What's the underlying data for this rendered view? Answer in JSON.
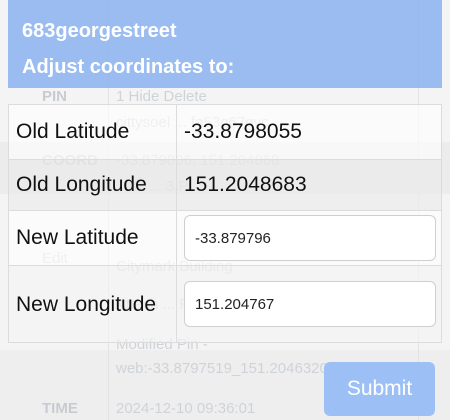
{
  "background": {
    "rows": [
      {
        "label": "PIN",
        "text": "1   Hide   Delete"
      },
      {
        "label": "",
        "text": "cittysoel ... fa53q67gyc"
      },
      {
        "label": "COORD",
        "text": "-33.879806, 151.204868"
      },
      {
        "label": "",
        "text": "...87 ... 3   P"
      },
      {
        "label": "",
        "text": "... Roof Boundary"
      },
      {
        "label": "Edit",
        "text": "Citymark Building"
      },
      {
        "label": "",
        "text": "Attach ... Report"
      },
      {
        "label": "",
        "text": "Modified Pin -"
      },
      {
        "label": "",
        "text": "web:-33.8797519_151.2046320"
      },
      {
        "label": "TIME",
        "text": "2024-12-10 09:36:01"
      }
    ]
  },
  "modal": {
    "name": "683georgestreet",
    "subtitle": "Adjust coordinates to:",
    "old_latitude_label": "Old Latitude",
    "old_latitude_value": "-33.8798055",
    "old_longitude_label": "Old Longitude",
    "old_longitude_value": "151.2048683",
    "new_latitude_label": "New Latitude",
    "new_latitude_value": "-33.879796",
    "new_longitude_label": "New Longitude",
    "new_longitude_value": "151.204767",
    "submit_label": "Submit"
  },
  "colors": {
    "header": "#8ab2f0",
    "submit": "#9cc0f5"
  }
}
